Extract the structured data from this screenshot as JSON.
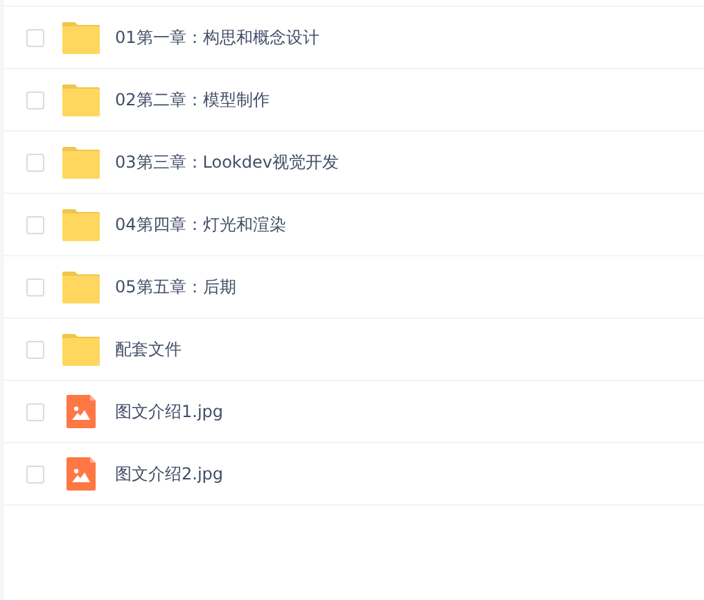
{
  "files": [
    {
      "name": "01第一章：构思和概念设计",
      "kind": "folder",
      "checked": false
    },
    {
      "name": "02第二章：模型制作",
      "kind": "folder",
      "checked": false
    },
    {
      "name": "03第三章：Lookdev视觉开发",
      "kind": "folder",
      "checked": false
    },
    {
      "name": "04第四章：灯光和渲染",
      "kind": "folder",
      "checked": false
    },
    {
      "name": "05第五章：后期",
      "kind": "folder",
      "checked": false
    },
    {
      "name": "配套文件",
      "kind": "folder",
      "checked": false
    },
    {
      "name": "图文介绍1.jpg",
      "kind": "image",
      "checked": false
    },
    {
      "name": "图文介绍2.jpg",
      "kind": "image",
      "checked": false
    }
  ]
}
